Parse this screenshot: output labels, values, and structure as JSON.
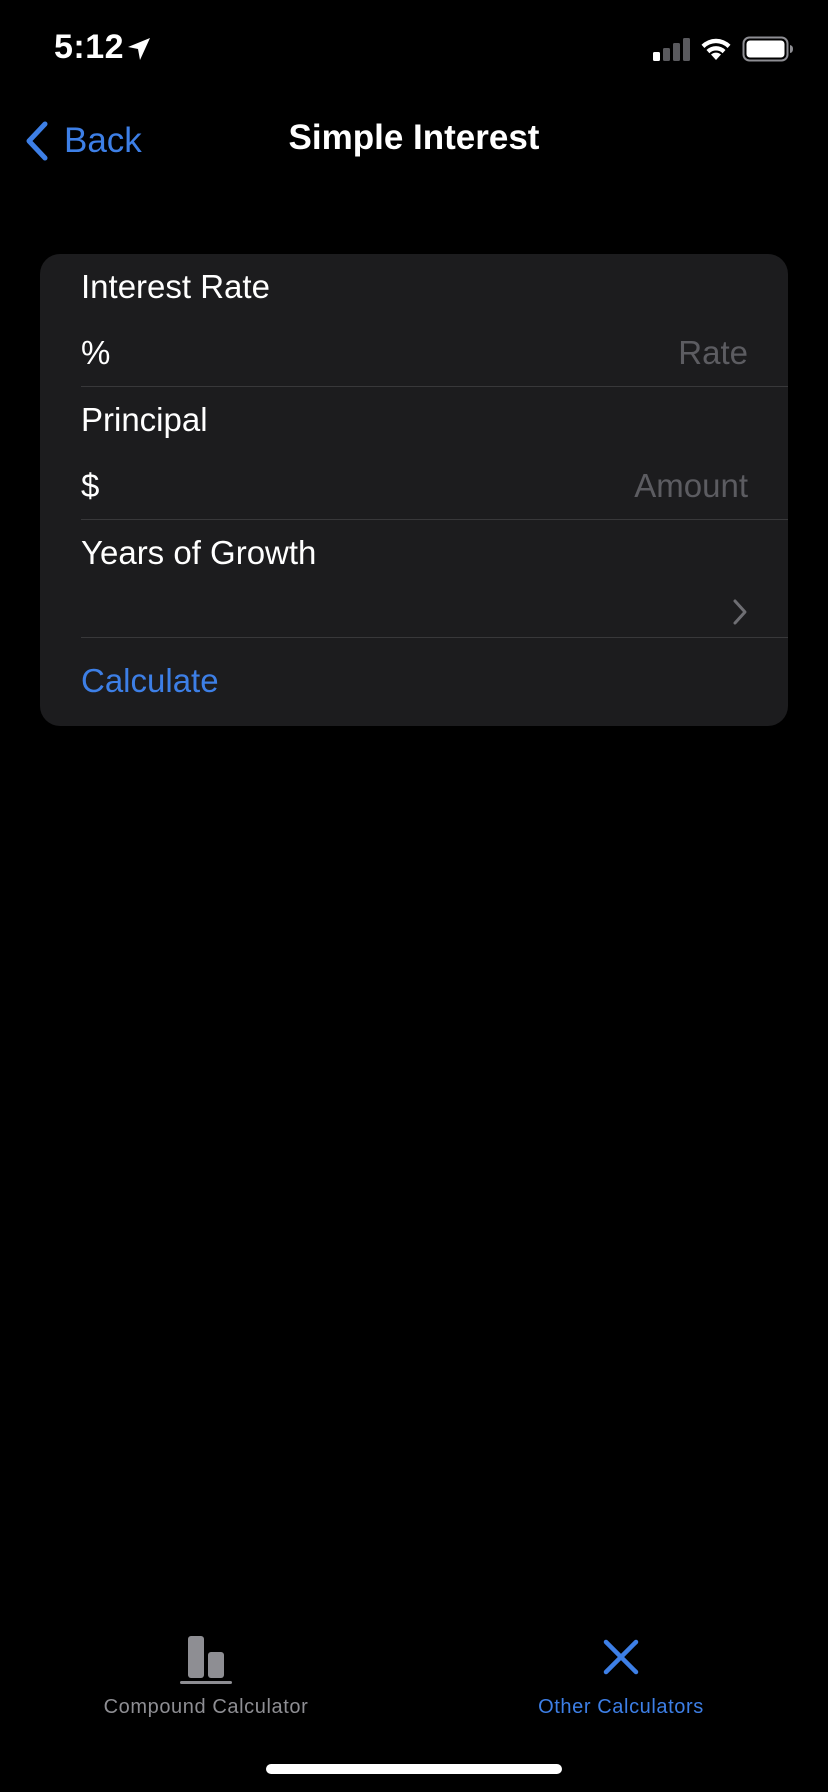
{
  "status_bar": {
    "time": "5:12",
    "location_icon": "location-arrow-icon",
    "signal_icon": "cellular-signal-icon",
    "wifi_icon": "wifi-icon",
    "battery_icon": "battery-icon"
  },
  "nav": {
    "back_label": "Back",
    "title": "Simple Interest"
  },
  "form": {
    "interest_rate": {
      "label": "Interest Rate",
      "prefix": "%",
      "value": "",
      "placeholder": "Rate"
    },
    "principal": {
      "label": "Principal",
      "prefix": "$",
      "value": "",
      "placeholder": "Amount"
    },
    "years": {
      "label": "Years of Growth",
      "value": ""
    },
    "calculate_label": "Calculate"
  },
  "tab_bar": {
    "tabs": [
      {
        "label": "Compound Calculator",
        "icon": "bar-chart-icon",
        "selected": false
      },
      {
        "label": "Other Calculators",
        "icon": "close-icon",
        "selected": true
      }
    ]
  },
  "colors": {
    "accent": "#3d7fe6",
    "background": "#000000",
    "card": "#1c1c1e",
    "placeholder": "#5c5c61",
    "divider": "#38383a",
    "inactive_tab": "#8e8e93"
  }
}
